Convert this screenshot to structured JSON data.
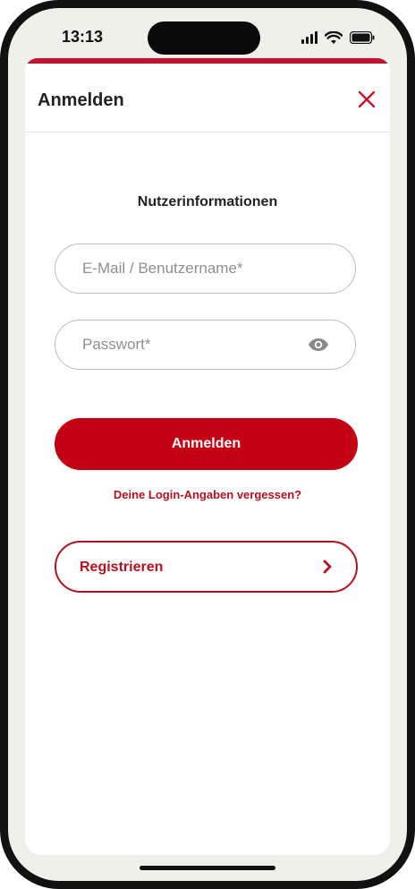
{
  "status_bar": {
    "time": "13:13"
  },
  "sheet": {
    "title": "Anmelden",
    "accent_color": "#c8102e",
    "close_icon": "close-icon"
  },
  "form": {
    "section_title": "Nutzerinformationen",
    "email_placeholder": "E-Mail / Benutzername*",
    "email_value": "",
    "password_placeholder": "Passwort*",
    "password_value": "",
    "password_visibility_icon": "eye-icon",
    "submit_label": "Anmelden",
    "forgot_label": "Deine Login-Angaben vergessen?"
  },
  "register": {
    "label": "Registrieren",
    "icon": "chevron-right-icon"
  },
  "colors": {
    "brand_red": "#c40014",
    "link_red": "#b5101f",
    "background": "#f0f0eb"
  }
}
